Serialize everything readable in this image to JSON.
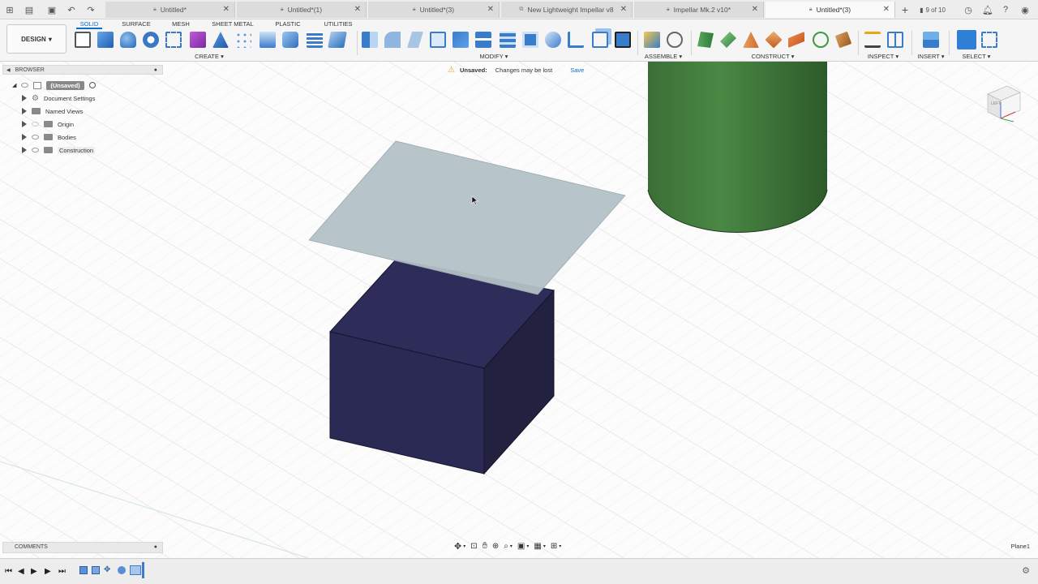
{
  "tabs": {
    "items": [
      {
        "label": "Untitled*",
        "active": false
      },
      {
        "label": "Untitled*(1)",
        "active": false
      },
      {
        "label": "Untitled*(3)",
        "active": false
      },
      {
        "label": "New Lightweight Impellar v8",
        "active": false
      },
      {
        "label": "Impellar Mk.2 v10*",
        "active": false
      },
      {
        "label": "Untitled*(3)",
        "active": true
      }
    ],
    "page_count": "9 of 10"
  },
  "toolbar": {
    "workspace_label": "DESIGN",
    "workspace_tabs": [
      "SOLID",
      "SURFACE",
      "MESH",
      "SHEET METAL",
      "PLASTIC",
      "UTILITIES"
    ],
    "groups": [
      "CREATE",
      "MODIFY",
      "ASSEMBLE",
      "CONSTRUCT",
      "INSPECT",
      "INSERT",
      "SELECT"
    ]
  },
  "browser": {
    "header": "BROWSER",
    "root": "(Unsaved)",
    "items": [
      "Document Settings",
      "Named Views",
      "Origin",
      "Bodies",
      "Construction"
    ]
  },
  "unsaved_bar": {
    "title": "Unsaved:",
    "message": "Changes may be lost",
    "save_label": "Save"
  },
  "viewcube": {
    "face_label": "LEFT"
  },
  "comments": {
    "label": "COMMENTS"
  },
  "status": {
    "selection_name": "Plane1"
  },
  "colors": {
    "accent": "#0f6ecd",
    "box_top": "#2e2d5a",
    "box_front": "#2b2a55",
    "box_side": "#22213f",
    "plane": "#b3c1c6",
    "cylinder": "#3f7a3a",
    "warning": "#e6a817"
  }
}
